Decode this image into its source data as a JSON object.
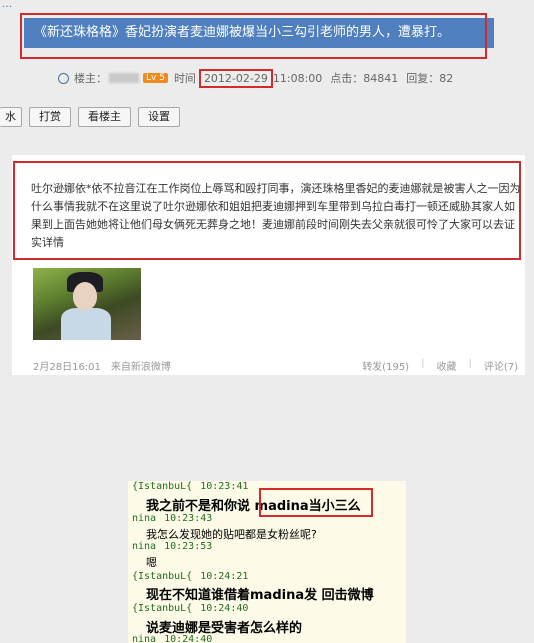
{
  "crumb": "…",
  "title": "《新还珠格格》香妃扮演者麦迪娜被爆当小三勾引老师的男人，遭暴打。",
  "meta": {
    "owner_label": "楼主：",
    "level": "Lv 5",
    "time_label": "时间",
    "date": "2012-02-29",
    "time": "11:08:00",
    "clicks_label": "点击：84841",
    "replies_label": "回复：82"
  },
  "buttons": [
    "水",
    "打赏",
    "看楼主",
    "设置"
  ],
  "weibo": {
    "text": "吐尔逊娜依*依不拉音江在工作岗位上辱骂和殴打同事，演还珠格里香妃的麦迪娜就是被害人之一因为什么事情我就不在这里说了吐尔逊娜依和姐姐把麦迪娜押到车里带到乌拉白毒打一顿还威胁其家人如果到上面告她她将让他们母女俩死无葬身之地！麦迪娜前段时间刚失去父亲就很可怜了大家可以去证实详情",
    "date": "2月28日16:01",
    "source": "来自新浪微博",
    "repost": "转发(195)",
    "fav": "收藏",
    "comment": "评论(7)"
  },
  "chat": {
    "rows": [
      {
        "kind": "hdr",
        "name": "{IstanbuL{",
        "time": "10:23:41"
      },
      {
        "kind": "msg",
        "text": "我之前不是和你说 madina当小三么"
      },
      {
        "kind": "hdr",
        "name": "nina",
        "time": "10:23:43"
      },
      {
        "kind": "msg-small",
        "text": "我怎么发现她的贴吧都是女粉丝呢?"
      },
      {
        "kind": "hdr",
        "name": "nina",
        "time": "10:23:53"
      },
      {
        "kind": "msg-small",
        "text": "嗯"
      },
      {
        "kind": "hdr",
        "name": "{IstanbuL{",
        "time": "10:24:21"
      },
      {
        "kind": "msg",
        "text": "现在不知道谁借着madina发 回击微博"
      },
      {
        "kind": "hdr",
        "name": "{IstanbuL{",
        "time": "10:24:40"
      },
      {
        "kind": "msg",
        "text": "说麦迪娜是受害者怎么样的"
      },
      {
        "kind": "hdr",
        "name": "nina",
        "time": "10:24:40"
      }
    ]
  },
  "colors": {
    "title_bg": "#4f7fbf",
    "highlight": "#d22b2b",
    "level": "#f08a1c"
  }
}
